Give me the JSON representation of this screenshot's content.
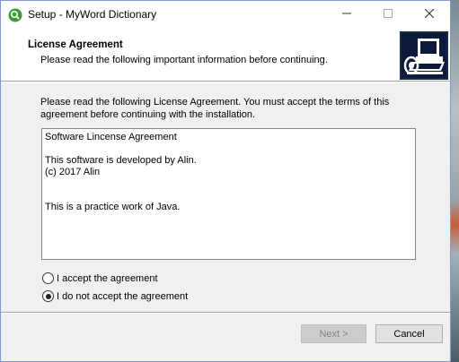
{
  "window": {
    "title": "Setup - MyWord Dictionary",
    "icon": "setup-icon",
    "controls": {
      "minimize": "minimize-icon",
      "maximize": "maximize-icon",
      "close": "close-icon"
    }
  },
  "header": {
    "title": "License Agreement",
    "subtitle": "Please read the following important information before continuing.",
    "logo": "installer-computer-icon"
  },
  "body": {
    "intro": "Please read the following License Agreement. You must accept the terms of this agreement before continuing with the installation.",
    "license_text": "Software Lincense Agreement\n\nThis software is developed by Alin.\n(c) 2017 Alin\n\n\nThis is a practice work of Java."
  },
  "options": {
    "accept_label": "I accept the agreement",
    "decline_label": "I do not accept the agreement",
    "selected": "decline"
  },
  "buttons": {
    "next_label": "Next >",
    "next_enabled": false,
    "cancel_label": "Cancel"
  }
}
